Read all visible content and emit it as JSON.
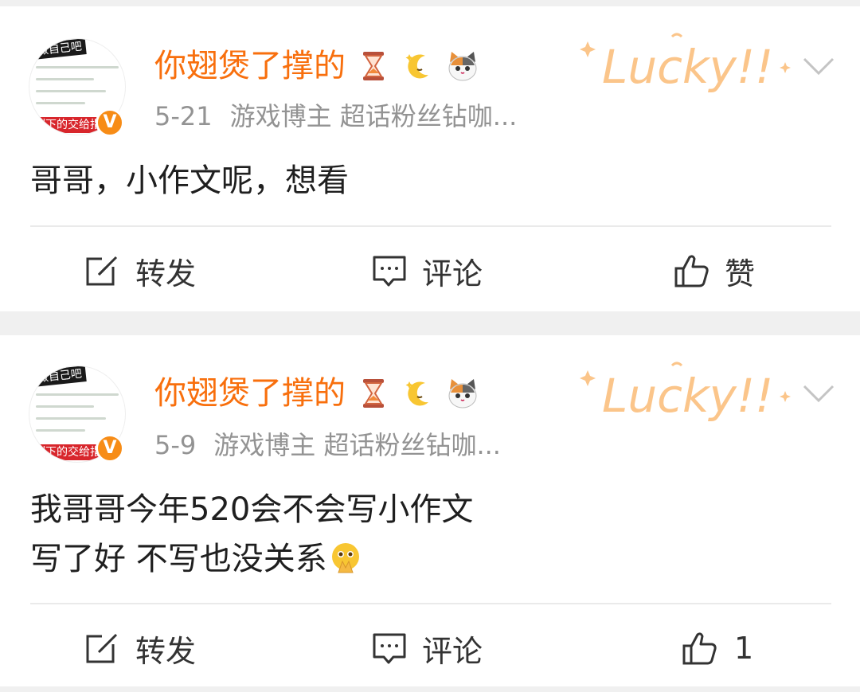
{
  "posts": [
    {
      "avatar": {
        "tag_top": "做自己吧",
        "tag_bottom": "剩下的交给指尖"
      },
      "username": "你翅煲了撑的",
      "date": "5-21",
      "description": "游戏博主 超话粉丝钻咖...",
      "text": "哥哥，小作文呢，想看",
      "actions": {
        "share": "转发",
        "comment": "评论",
        "like": "赞"
      }
    },
    {
      "avatar": {
        "tag_top": "做自己吧",
        "tag_bottom": "剩下的交给指尖"
      },
      "username": "你翅煲了撑的",
      "date": "5-9",
      "description": "游戏博主 超话粉丝钻咖...",
      "text": "我哥哥今年520会不会写小作文\n写了好 不写也没关系",
      "text_emoji": "pleading-hands-emoji",
      "actions": {
        "share": "转发",
        "comment": "评论",
        "like": "1"
      }
    }
  ],
  "decor": {
    "badge_text": "Lucky!!",
    "verified_badge": "V"
  },
  "colors": {
    "username": "#f86f0d",
    "meta": "#939393",
    "background": "#f0f0f0",
    "badge": "#f78c16"
  },
  "icons": {
    "hourglass": "hourglass-icon",
    "moon": "moon-icon",
    "cat": "cat-icon",
    "share": "share-edit-icon",
    "comment": "comment-icon",
    "like": "thumbs-up-icon",
    "chevron": "chevron-down-icon"
  }
}
